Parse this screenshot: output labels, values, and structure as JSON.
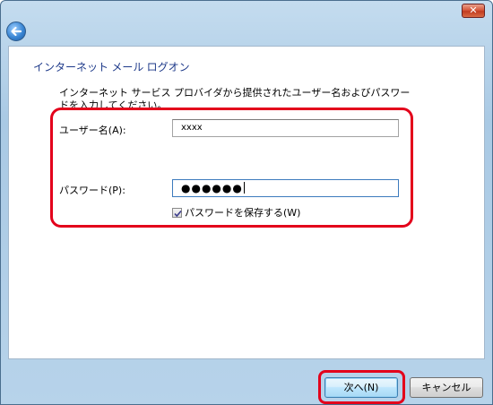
{
  "window": {
    "close_label": "✕"
  },
  "nav": {
    "back_icon": "back-arrow-icon"
  },
  "page": {
    "heading": "インターネット メール ログオン",
    "instruction": "インターネット サービス プロバイダから提供されたユーザー名およびパスワードを入力してください。",
    "username_label": "ユーザー名(A):",
    "username_value": "xxxx",
    "password_label": "パスワード(P):",
    "password_value": "●●●●●●",
    "remember_label": "パスワードを保存する(W)",
    "remember_checked": true
  },
  "footer": {
    "next_label": "次へ(N)",
    "cancel_label": "キャンセル"
  },
  "colors": {
    "highlight": "#e3001b",
    "heading": "#1e3a8a"
  }
}
